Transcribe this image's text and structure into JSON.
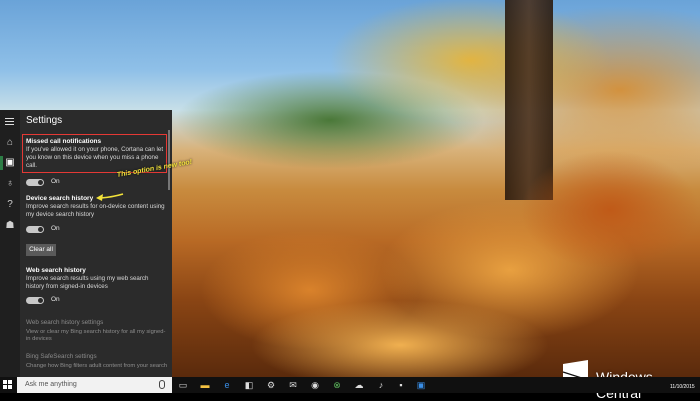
{
  "panel": {
    "title": "Settings",
    "accent_color": "#2d7d46",
    "rail_icons": [
      "hamburger-icon",
      "home-icon",
      "notebook-icon",
      "lightbulb-icon",
      "help-icon",
      "feedback-icon"
    ]
  },
  "settings": {
    "missed_calls": {
      "heading": "Missed call notifications",
      "description": "If you've allowed it on your phone, Cortana can let you know on this device when you miss a phone call.",
      "toggle_state": "On"
    },
    "device_search": {
      "heading": "Device search history",
      "description": "Improve search results for on-device content using my device search history",
      "toggle_state": "On",
      "clear_button": "Clear all"
    },
    "web_search": {
      "heading": "Web search history",
      "description": "Improve search results using my web search history from signed-in devices",
      "toggle_state": "On"
    },
    "web_history_settings": {
      "link": "Web search history settings",
      "description": "View or clear my Bing search history for all my signed-in devices"
    },
    "safesearch": {
      "link": "Bing SafeSearch settings",
      "description": "Change how Bing filters adult content from your search"
    }
  },
  "annotation": {
    "text": "This option is new too!",
    "highlight_color": "#e53935",
    "arrow_color": "#f2e23a"
  },
  "taskbar": {
    "search_placeholder": "Ask me anything",
    "icons": [
      "task-view-icon",
      "file-explorer-icon",
      "edge-icon",
      "store-icon",
      "settings-icon",
      "mail-icon",
      "photos-icon",
      "xbox-icon",
      "onedrive-icon",
      "groove-icon",
      "cmd-icon",
      "remote-desktop-icon"
    ],
    "clock_date": "11/10/2015"
  },
  "watermark": {
    "text": "Windows Central"
  }
}
